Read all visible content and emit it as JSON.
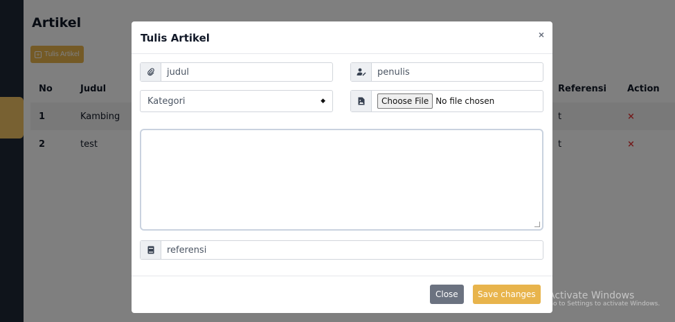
{
  "page": {
    "title": "Artikel",
    "write_button": "Tulis Artikel",
    "table": {
      "headers": [
        "No",
        "Judul",
        "Referensi",
        "Action"
      ],
      "rows": [
        {
          "no": "1",
          "judul": "Kambing",
          "referensi": "t",
          "action": "×"
        },
        {
          "no": "2",
          "judul": "test",
          "referensi": "t",
          "action": "×"
        }
      ]
    }
  },
  "modal": {
    "title": "Tulis Artikel",
    "close_icon": "×",
    "judul_placeholder": "judul",
    "penulis_placeholder": "penulis",
    "kategori_selected": "Kategori",
    "file_button": "Choose File",
    "file_status": "No file chosen",
    "referensi_placeholder": "referensi",
    "close_button": "Close",
    "save_button": "Save changes"
  },
  "watermark": {
    "line1": "Activate Windows",
    "line2": "Go to Settings to activate Windows."
  },
  "colors": {
    "accent": "#e8b44c",
    "danger": "#e63b3b",
    "secondary": "#6b7280"
  }
}
